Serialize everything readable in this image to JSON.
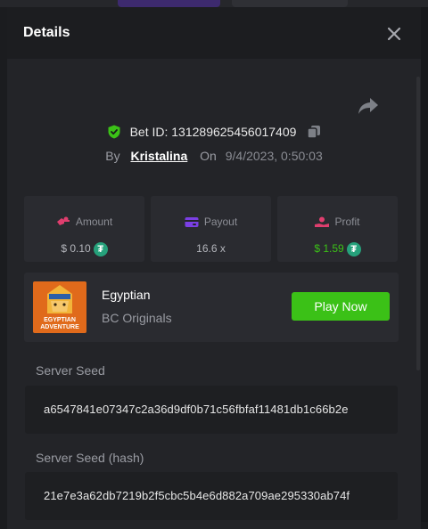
{
  "modal": {
    "title": "Details"
  },
  "bet": {
    "id_label": "Bet ID:",
    "id": "131289625456017409",
    "by_label": "By",
    "user": "Kristalina",
    "on_label": "On",
    "datetime": "9/4/2023, 0:50:03"
  },
  "stats": {
    "amount": {
      "label": "Amount",
      "value": "$ 0.10",
      "coin_icon": "tether-icon"
    },
    "payout": {
      "label": "Payout",
      "value": "16.6 x"
    },
    "profit": {
      "label": "Profit",
      "value": "$ 1.59",
      "coin_icon": "tether-icon",
      "color": "#3bc117"
    }
  },
  "game": {
    "name": "Egyptian",
    "provider": "BC Originals",
    "thumb_text": [
      "EGYPTIAN",
      "ADVENTURE"
    ],
    "play_label": "Play Now"
  },
  "seeds": {
    "server_seed_label": "Server Seed",
    "server_seed": "a6547841e07347c2a36d9df0b71c56fbfaf11481db1c66b2e",
    "server_seed_hash_label": "Server Seed (hash)",
    "server_seed_hash": "21e7e3a62db7219b2f5cbc5b4e6d882a709ae295330ab74f"
  },
  "colors": {
    "accent_green": "#3bc117",
    "tether": "#26a17b",
    "payout_icon": "#7b3fe4",
    "amount_icon": "#e03e6e"
  }
}
